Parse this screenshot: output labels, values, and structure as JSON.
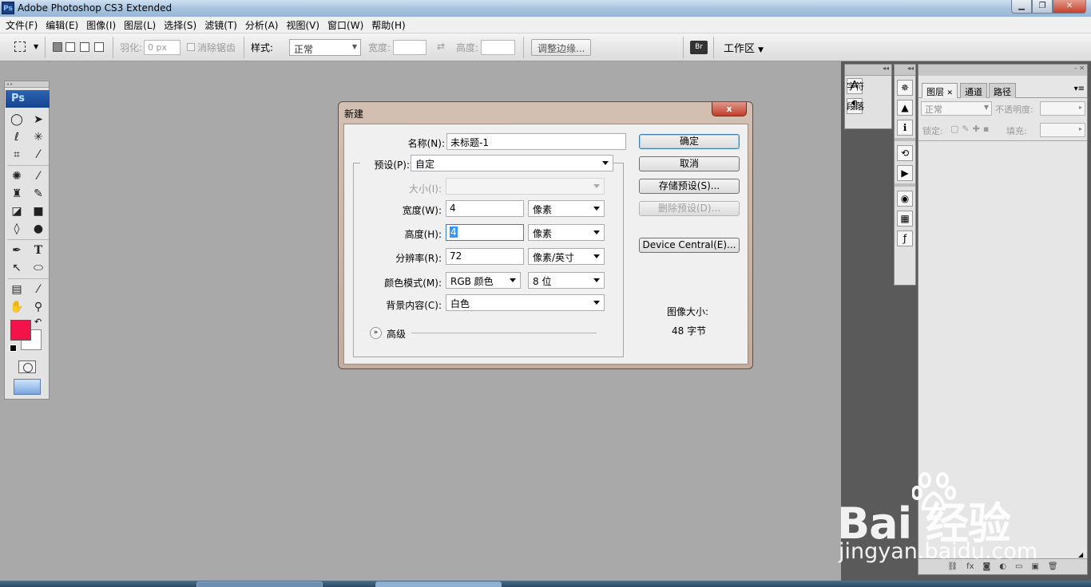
{
  "window": {
    "app_icon": "Ps",
    "title": "Adobe Photoshop CS3 Extended"
  },
  "menu": [
    "文件(F)",
    "编辑(E)",
    "图像(I)",
    "图层(L)",
    "选择(S)",
    "滤镜(T)",
    "分析(A)",
    "视图(V)",
    "窗口(W)",
    "帮助(H)"
  ],
  "options": {
    "feather_label": "羽化:",
    "feather_value": "0 px",
    "antialias_label": "消除锯齿",
    "style_label": "样式:",
    "style_value": "正常",
    "width_label": "宽度:",
    "height_label": "高度:",
    "refine_edge": "调整边缘...",
    "workspace": "工作区"
  },
  "toolbox": {
    "logo": "Ps",
    "foreground_color": "#f4124a",
    "background_color": "#ffffff"
  },
  "dock": {
    "character": "字符",
    "paragraph": "段落"
  },
  "layers_panel": {
    "tabs": [
      "图层",
      "通道",
      "路径"
    ],
    "blend_mode": "正常",
    "opacity_label": "不透明度:",
    "lock_label": "锁定:",
    "fill_label": "填充:"
  },
  "dialog": {
    "title": "新建",
    "close": "x",
    "name_label": "名称(N):",
    "name_value": "未标题-1",
    "preset_label": "预设(P):",
    "preset_value": "自定",
    "size_label": "大小(I):",
    "width_label": "宽度(W):",
    "width_value": "4",
    "width_unit": "像素",
    "height_label": "高度(H):",
    "height_value": "4",
    "height_unit": "像素",
    "resolution_label": "分辨率(R):",
    "resolution_value": "72",
    "resolution_unit": "像素/英寸",
    "color_mode_label": "颜色模式(M):",
    "color_mode_value": "RGB 颜色",
    "bit_depth_value": "8 位",
    "background_label": "背景内容(C):",
    "background_value": "白色",
    "advanced_label": "高级",
    "ok": "确定",
    "cancel": "取消",
    "save_preset": "存储预设(S)...",
    "delete_preset": "删除预设(D)...",
    "device_central": "Device Central(E)...",
    "image_size_label": "图像大小:",
    "image_size_value": "48 字节"
  },
  "watermark": {
    "brand": "Bai  经验",
    "url": "jingyan.baidu.com"
  }
}
